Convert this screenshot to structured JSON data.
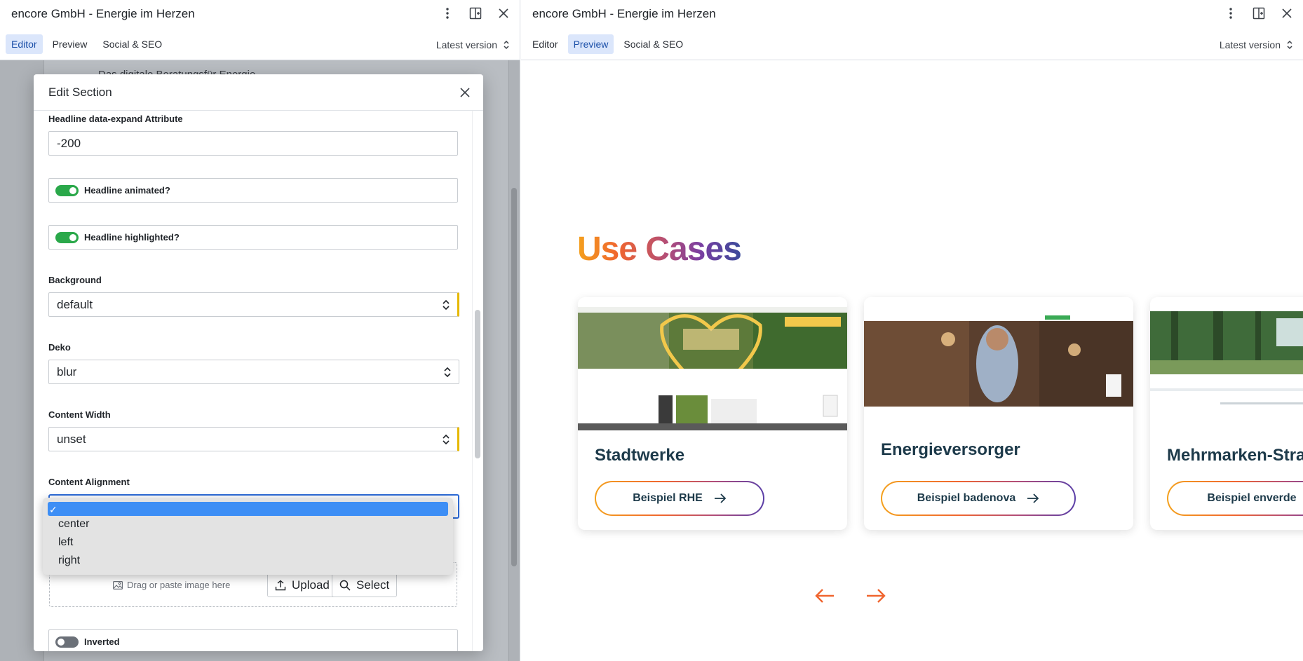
{
  "left_pane": {
    "title": "encore GmbH - Energie im Herzen",
    "tabs": [
      "Editor",
      "Preview",
      "Social & SEO"
    ],
    "active_tab": "Editor",
    "version_label": "Latest version",
    "background_doc_text": "Das digitale Beratungsfür Energie"
  },
  "right_pane": {
    "title": "encore GmbH - Energie im Herzen",
    "tabs": [
      "Editor",
      "Preview",
      "Social & SEO"
    ],
    "active_tab": "Preview",
    "version_label": "Latest version"
  },
  "dialog": {
    "title": "Edit Section",
    "headline_expand": {
      "label": "Headline data-expand Attribute",
      "value": "-200"
    },
    "headline_animated": {
      "label": "Headline animated?",
      "on": true
    },
    "headline_highlighted": {
      "label": "Headline highlighted?",
      "on": true
    },
    "background": {
      "label": "Background",
      "value": "default"
    },
    "deko": {
      "label": "Deko",
      "value": "blur"
    },
    "content_width": {
      "label": "Content Width",
      "value": "unset"
    },
    "content_alignment": {
      "label": "Content Alignment",
      "value": "",
      "options": [
        "",
        "center",
        "left",
        "right"
      ],
      "selected_index": 0
    },
    "image_drop": {
      "placeholder": "Drag or paste image here",
      "upload_label": "Upload",
      "select_label": "Select"
    },
    "inverted": {
      "label": "Inverted",
      "on": false
    }
  },
  "preview": {
    "headline": "Use Cases",
    "cards": [
      {
        "title": "Stadtwerke",
        "button": "Beispiel RHE"
      },
      {
        "title": "Energieversorger",
        "button": "Beispiel badenova"
      },
      {
        "title": "Mehrmarken-Strategie",
        "button": "Beispiel enverde"
      }
    ],
    "accent_colors": {
      "orange": "#f0652f",
      "navy": "#1d3a4a",
      "toggle_green": "#2aa84a",
      "focus_blue": "#2c6ad6"
    }
  }
}
